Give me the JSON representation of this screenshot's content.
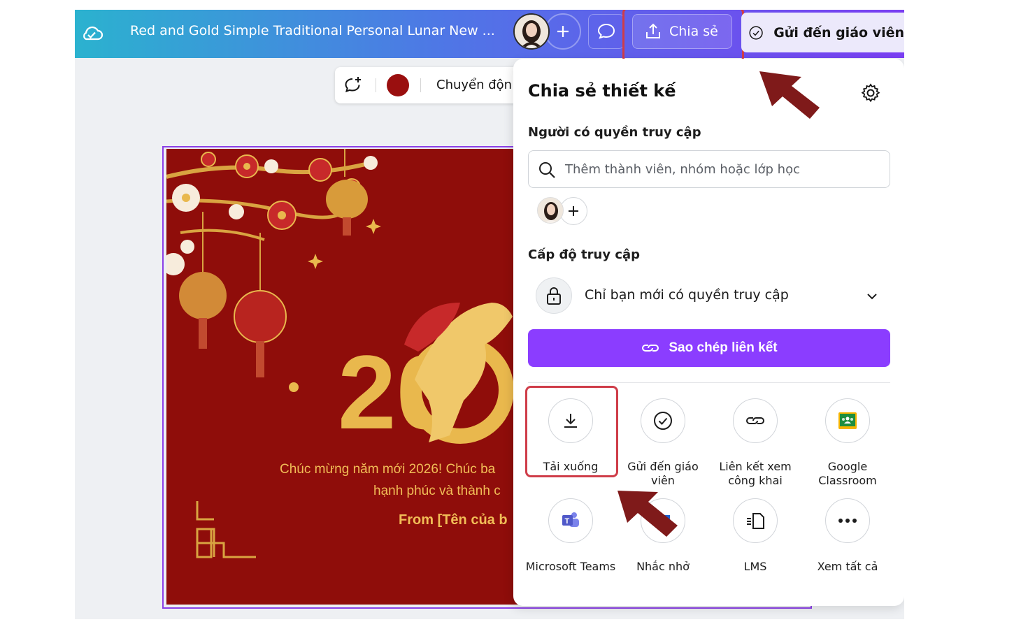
{
  "topbar": {
    "doc_title": "Red and Gold Simple Traditional Personal Lunar New ...",
    "share_label": "Chia sẻ",
    "send_teacher_label": "Gửi đến giáo viên"
  },
  "toolbar": {
    "animate_label": "Chuyển độn",
    "color": "#9a0f0f"
  },
  "canvas": {
    "greeting_line1": "Chúc mừng năm mới 2026! Chúc ba",
    "greeting_line2": "hạnh phúc và thành c",
    "from_text": "From [Tên của b",
    "year_partial": "20"
  },
  "share_panel": {
    "title": "Chia sẻ thiết kế",
    "people_label": "Người có quyền truy cập",
    "search_placeholder": "Thêm thành viên, nhóm hoặc lớp học",
    "access_level_label": "Cấp độ truy cập",
    "access_value": "Chỉ bạn mới có quyền truy cập",
    "copy_link_label": "Sao chép liên kết",
    "options": [
      {
        "label": "Tải xuống",
        "icon": "download-icon"
      },
      {
        "label": "Gửi đến giáo viên",
        "icon": "check-circle-icon"
      },
      {
        "label": "Liên kết xem công khai",
        "icon": "link-icon"
      },
      {
        "label": "Google Classroom",
        "icon": "google-classroom-icon"
      },
      {
        "label": "Microsoft Teams",
        "icon": "microsoft-teams-icon"
      },
      {
        "label": "Nhắc nhở",
        "icon": "reminder-icon"
      },
      {
        "label": "LMS",
        "icon": "lms-icon"
      },
      {
        "label": "Xem tất cả",
        "icon": "more-icon"
      }
    ]
  },
  "colors": {
    "accent_purple": "#8b3dff",
    "highlight_red": "#cf3d49",
    "arrow_red": "#7f1a1a",
    "canvas_red": "#8f0d0a",
    "gold": "#f1bd57"
  }
}
